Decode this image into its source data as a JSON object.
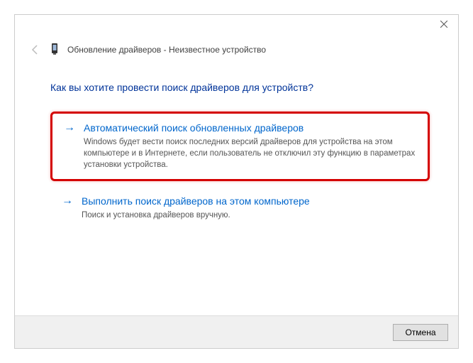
{
  "header": {
    "title": "Обновление драйверов - Неизвестное устройство"
  },
  "question": "Как вы хотите провести поиск драйверов для устройств?",
  "options": [
    {
      "title": "Автоматический поиск обновленных драйверов",
      "description": "Windows будет вести поиск последних версий драйверов для устройства на этом компьютере и в Интернете, если пользователь не отключил эту функцию в параметрах установки устройства."
    },
    {
      "title": "Выполнить поиск драйверов на этом компьютере",
      "description": "Поиск и установка драйверов вручную."
    }
  ],
  "footer": {
    "cancel_label": "Отмена"
  }
}
